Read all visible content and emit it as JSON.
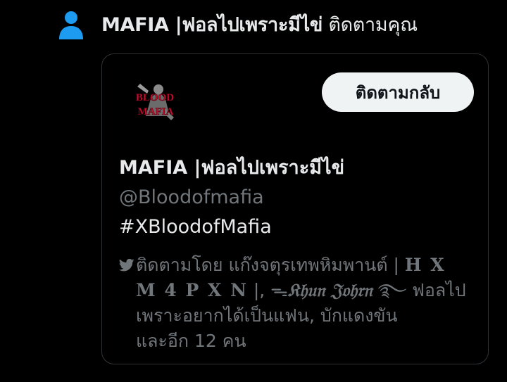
{
  "notification": {
    "icon": "person-icon",
    "actor_name": "MAFIA |ฟอลไปเพราะมีไข่",
    "action_text": "ติดตามคุณ"
  },
  "card": {
    "avatar_text_top": "BLOOD",
    "avatar_text_bottom": "MAFIA",
    "follow_back_label": "ติดตามกลับ",
    "display_name": "MAFIA |ฟอลไปเพราะมีไข่",
    "handle": "@Bloodofmafia",
    "bio": "#XBloodofMafia",
    "followed_by": {
      "prefix": "ติดตามโดย แก๊งจตุรเทพหิมพานต์ | ",
      "name1_part1": "H X",
      "name1_part2": "M 4 P X N",
      "separator": " |, ",
      "name2": "𝔎𝔥𝔲𝔫 𝔍𝔬𝔥𝔯𝔫",
      "name2_prefix": "ᯓ",
      "name2_suffix": " ࿐ ฟอลไป",
      "line3": "เพราะอยากได้เป็นแฟน, บักแดงขัน",
      "line4": "และอีก 12 คน"
    }
  },
  "colors": {
    "background": "#000000",
    "text_primary": "#e7e9ea",
    "text_secondary": "#71767b",
    "accent_blue": "#1d9bf0",
    "button_bg": "#eff3f4",
    "card_border": "#2f3336",
    "avatar_red": "#c8102e"
  }
}
